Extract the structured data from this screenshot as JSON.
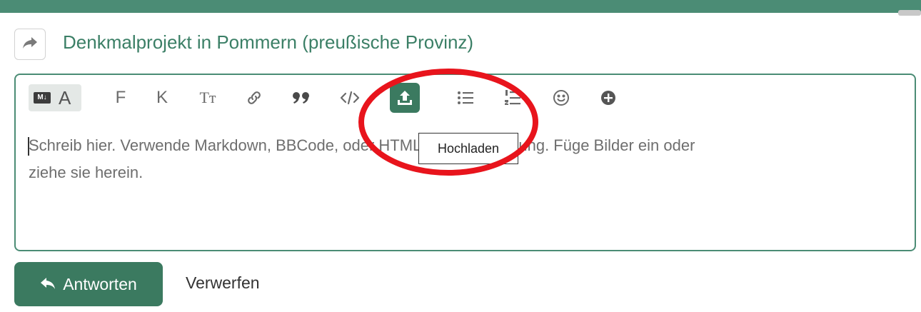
{
  "composer": {
    "reply_to_title": "Denkmalprojekt in Pommern (preußische Provinz)",
    "toolbar": {
      "markdown_badge": "M↓",
      "rich_text_letter": "A",
      "bold_letter": "F",
      "italic_letter": "K",
      "heading_letter": "Tт",
      "items": [
        "toggle-markdown",
        "bold",
        "italic",
        "heading",
        "link",
        "quote",
        "code",
        "upload",
        "bullet-list",
        "numbered-list",
        "emoji",
        "more-options"
      ]
    },
    "placeholder": "Schreib hier. Verwende Markdown, BBCode, oder HTML zur Formatierung. Füge Bilder ein oder ziehe sie herein.",
    "placeholder_line1": "Schreib hier. Verwende Markdown, BBCode, oder HTML zur Formatierung. Füge Bilder ein oder",
    "placeholder_line2": "ziehe sie herein.",
    "tooltip": "Hochladen",
    "reply_button": "Antworten",
    "discard_link": "Verwerfen"
  },
  "colors": {
    "accent": "#3b7a60",
    "link": "#3b7f66",
    "annotation": "#e8141c"
  }
}
